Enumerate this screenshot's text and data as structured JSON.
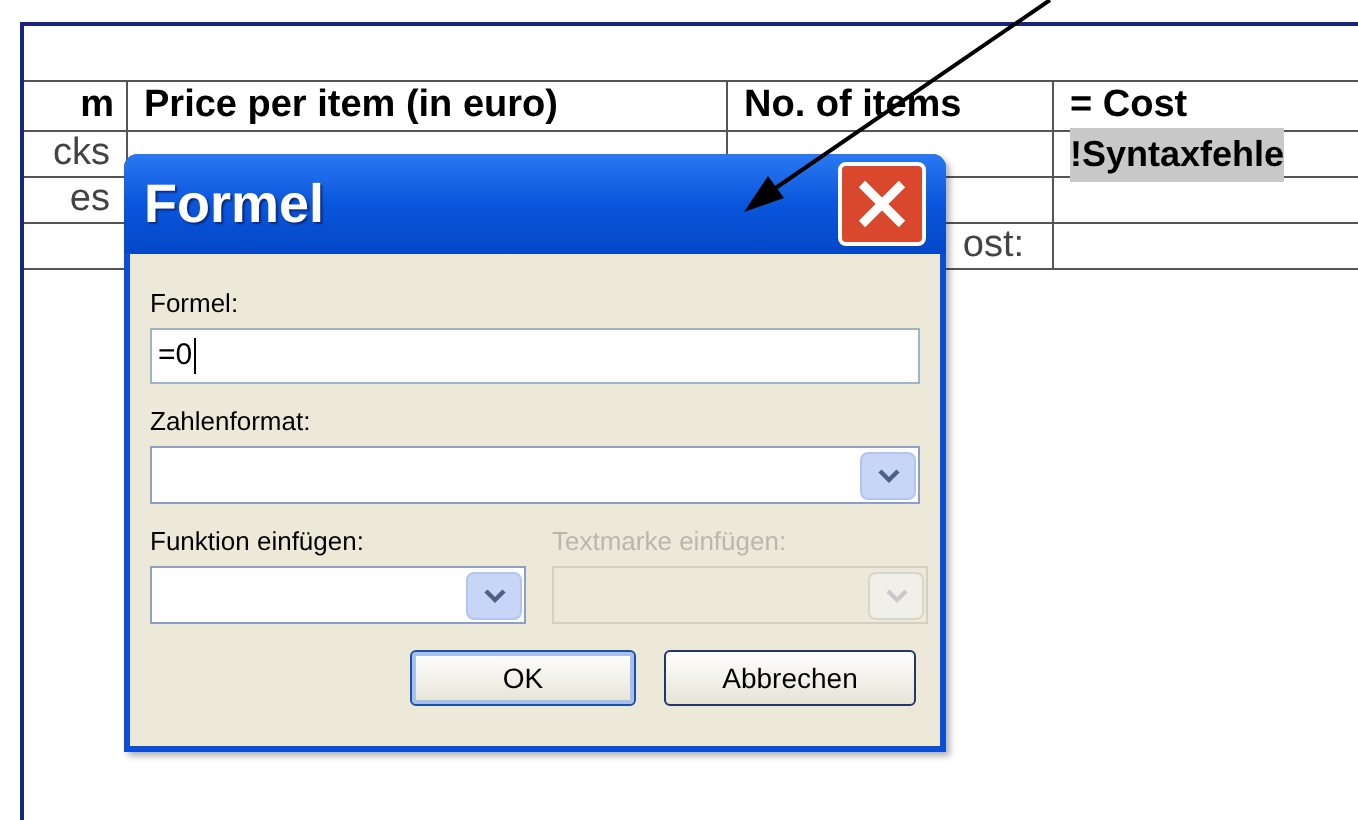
{
  "document": {
    "table": {
      "columns": [
        "m",
        "Price per item (in euro)",
        "No. of items",
        "= Cost"
      ],
      "rows": [
        {
          "item": "cks",
          "cost": "!Syntaxfehle",
          "cost_shaded": true
        },
        {
          "item": "es"
        },
        {
          "count": "ost:"
        }
      ]
    }
  },
  "dialog": {
    "title": "Formel",
    "fields": [
      {
        "kind": "text",
        "label": "Formel:",
        "value": "=0",
        "focused": true
      },
      {
        "kind": "combo",
        "label": "Zahlenformat:",
        "disabled": false
      }
    ],
    "pairs": [
      {
        "kind": "combo",
        "label": "Funktion einfügen:",
        "disabled": false
      },
      {
        "kind": "combo",
        "label": "Textmarke einfügen:",
        "disabled": true
      }
    ],
    "buttons": [
      {
        "label": "OK",
        "default": true
      },
      {
        "label": "Abbrechen",
        "default": false
      }
    ]
  }
}
